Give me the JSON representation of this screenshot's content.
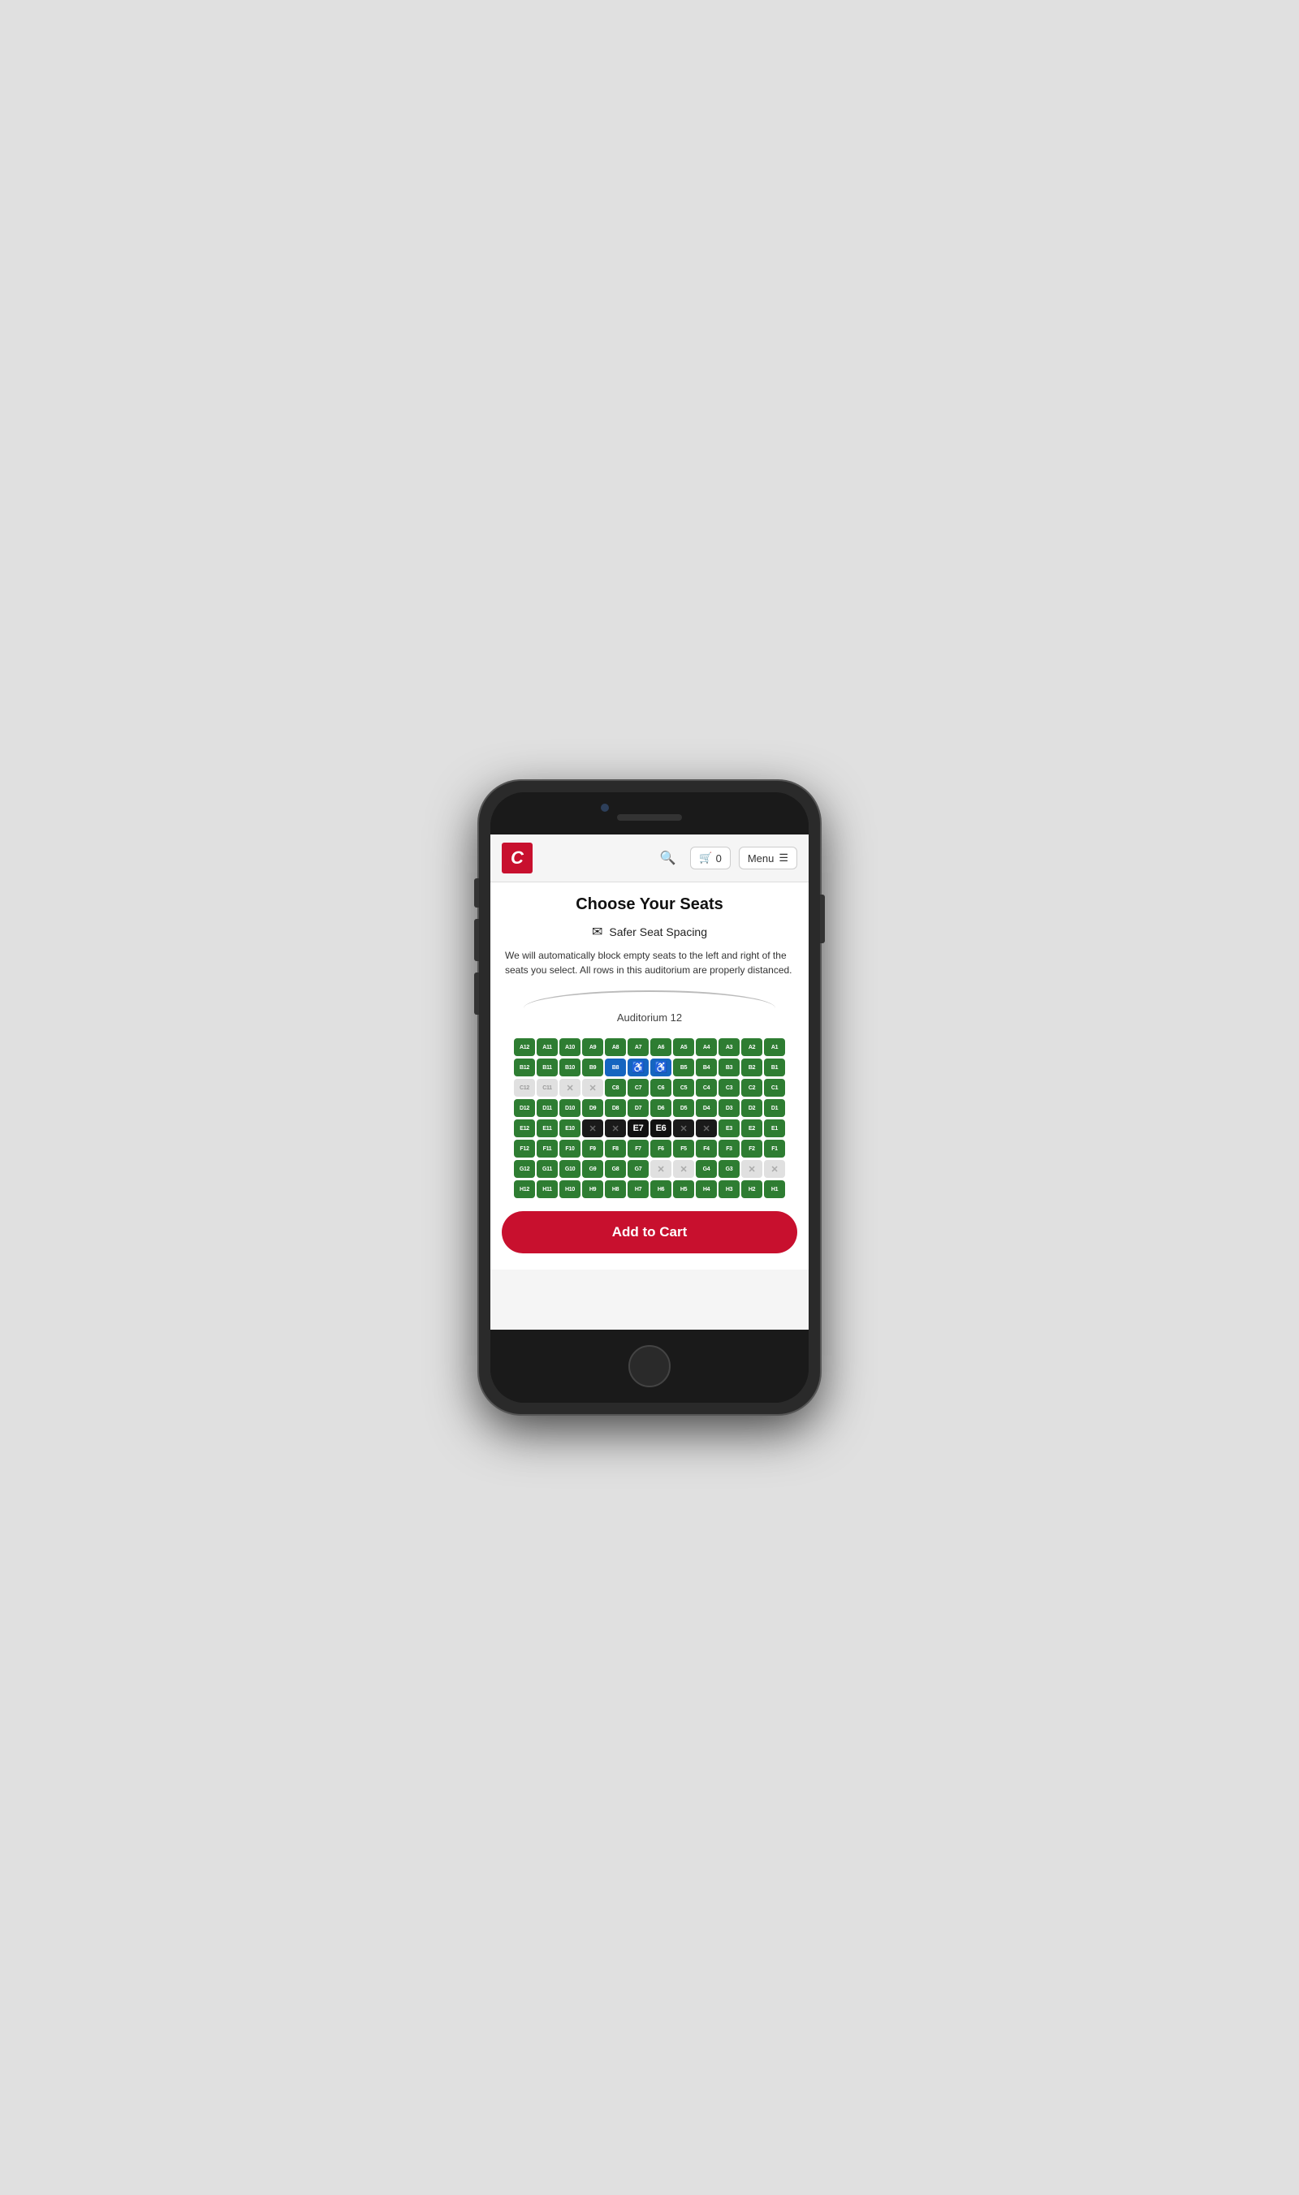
{
  "header": {
    "logo_text": "C",
    "cart_count": "0",
    "menu_label": "Menu"
  },
  "page": {
    "title": "Choose Your Seats",
    "safer_spacing_label": "Safer Seat Spacing",
    "safer_spacing_desc": "We will automatically block empty seats to the left and right of the seats you select. All rows in this auditorium are properly distanced.",
    "auditorium_label": "Auditorium 12"
  },
  "add_to_cart": "Add to Cart",
  "rows": [
    {
      "id": "A",
      "seats": [
        {
          "label": "A12",
          "type": "available"
        },
        {
          "label": "A11",
          "type": "available"
        },
        {
          "label": "A10",
          "type": "available"
        },
        {
          "label": "A9",
          "type": "available"
        },
        {
          "label": "A8",
          "type": "available"
        },
        {
          "label": "A7",
          "type": "available"
        },
        {
          "label": "A6",
          "type": "available"
        },
        {
          "label": "A5",
          "type": "available"
        },
        {
          "label": "A4",
          "type": "available"
        },
        {
          "label": "A3",
          "type": "available"
        },
        {
          "label": "A2",
          "type": "available"
        },
        {
          "label": "A1",
          "type": "available"
        }
      ]
    },
    {
      "id": "B",
      "seats": [
        {
          "label": "B12",
          "type": "available"
        },
        {
          "label": "B11",
          "type": "available"
        },
        {
          "label": "B10",
          "type": "available"
        },
        {
          "label": "B9",
          "type": "available"
        },
        {
          "label": "B8",
          "type": "selected-blue"
        },
        {
          "label": "♿",
          "type": "wheelchair"
        },
        {
          "label": "♿",
          "type": "wheelchair"
        },
        {
          "label": "B5",
          "type": "available"
        },
        {
          "label": "B4",
          "type": "available"
        },
        {
          "label": "B3",
          "type": "available"
        },
        {
          "label": "B2",
          "type": "available"
        },
        {
          "label": "B1",
          "type": "available"
        }
      ]
    },
    {
      "id": "C",
      "seats": [
        {
          "label": "C12",
          "type": "blocked"
        },
        {
          "label": "C11",
          "type": "blocked"
        },
        {
          "label": "✕",
          "type": "blocked-x"
        },
        {
          "label": "✕",
          "type": "blocked-x"
        },
        {
          "label": "C8",
          "type": "available"
        },
        {
          "label": "C7",
          "type": "available"
        },
        {
          "label": "C6",
          "type": "available"
        },
        {
          "label": "C5",
          "type": "available"
        },
        {
          "label": "C4",
          "type": "available"
        },
        {
          "label": "C3",
          "type": "available"
        },
        {
          "label": "C2",
          "type": "available"
        },
        {
          "label": "C1",
          "type": "available"
        }
      ]
    },
    {
      "id": "D",
      "seats": [
        {
          "label": "D12",
          "type": "available"
        },
        {
          "label": "D11",
          "type": "available"
        },
        {
          "label": "D10",
          "type": "available"
        },
        {
          "label": "D9",
          "type": "available"
        },
        {
          "label": "D8",
          "type": "available"
        },
        {
          "label": "D7",
          "type": "available"
        },
        {
          "label": "D6",
          "type": "available"
        },
        {
          "label": "D5",
          "type": "available"
        },
        {
          "label": "D4",
          "type": "available"
        },
        {
          "label": "D3",
          "type": "available"
        },
        {
          "label": "D2",
          "type": "available"
        },
        {
          "label": "D1",
          "type": "available"
        }
      ]
    },
    {
      "id": "E",
      "seats": [
        {
          "label": "E12",
          "type": "available"
        },
        {
          "label": "E11",
          "type": "available"
        },
        {
          "label": "E10",
          "type": "available"
        },
        {
          "label": "✕",
          "type": "occupied"
        },
        {
          "label": "✕",
          "type": "occupied"
        },
        {
          "label": "E7",
          "type": "selected-dark"
        },
        {
          "label": "E6",
          "type": "selected-dark"
        },
        {
          "label": "✕",
          "type": "occupied"
        },
        {
          "label": "✕",
          "type": "occupied"
        },
        {
          "label": "E3",
          "type": "available"
        },
        {
          "label": "E2",
          "type": "available"
        },
        {
          "label": "E1",
          "type": "available"
        }
      ]
    },
    {
      "id": "F",
      "seats": [
        {
          "label": "F12",
          "type": "available"
        },
        {
          "label": "F11",
          "type": "available"
        },
        {
          "label": "F10",
          "type": "available"
        },
        {
          "label": "F9",
          "type": "available"
        },
        {
          "label": "F8",
          "type": "available"
        },
        {
          "label": "F7",
          "type": "available"
        },
        {
          "label": "F6",
          "type": "available"
        },
        {
          "label": "F5",
          "type": "available"
        },
        {
          "label": "F4",
          "type": "available"
        },
        {
          "label": "F3",
          "type": "available"
        },
        {
          "label": "F2",
          "type": "available"
        },
        {
          "label": "F1",
          "type": "available"
        }
      ]
    },
    {
      "id": "G",
      "seats": [
        {
          "label": "G12",
          "type": "available"
        },
        {
          "label": "G11",
          "type": "available"
        },
        {
          "label": "G10",
          "type": "available"
        },
        {
          "label": "G9",
          "type": "available"
        },
        {
          "label": "G8",
          "type": "available"
        },
        {
          "label": "G7",
          "type": "available"
        },
        {
          "label": "✕",
          "type": "blocked-x"
        },
        {
          "label": "✕",
          "type": "blocked-x"
        },
        {
          "label": "G4",
          "type": "available"
        },
        {
          "label": "G3",
          "type": "available"
        },
        {
          "label": "✕",
          "type": "blocked-x"
        },
        {
          "label": "✕",
          "type": "blocked-x"
        }
      ]
    },
    {
      "id": "H",
      "seats": [
        {
          "label": "H12",
          "type": "available"
        },
        {
          "label": "H11",
          "type": "available"
        },
        {
          "label": "H10",
          "type": "available"
        },
        {
          "label": "H9",
          "type": "available"
        },
        {
          "label": "H8",
          "type": "available"
        },
        {
          "label": "H7",
          "type": "available"
        },
        {
          "label": "H6",
          "type": "available"
        },
        {
          "label": "H5",
          "type": "available"
        },
        {
          "label": "H4",
          "type": "available"
        },
        {
          "label": "H3",
          "type": "available"
        },
        {
          "label": "H2",
          "type": "available"
        },
        {
          "label": "H1",
          "type": "available"
        }
      ]
    }
  ]
}
